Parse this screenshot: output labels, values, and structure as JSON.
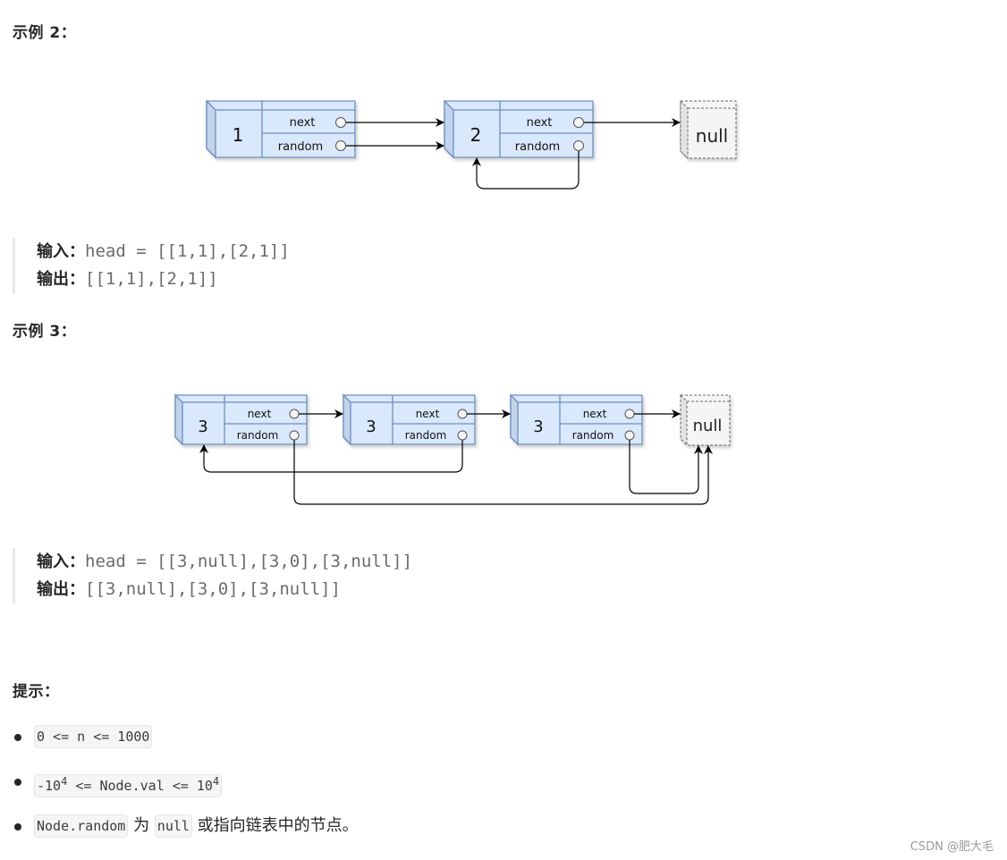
{
  "example2": {
    "heading": "示例 2：",
    "nodes": [
      {
        "val": "1",
        "next_label": "next",
        "random_label": "random"
      },
      {
        "val": "2",
        "next_label": "next",
        "random_label": "random"
      }
    ],
    "null_label": "null",
    "input_label": "输入：",
    "input_value": "head = [[1,1],[2,1]]",
    "output_label": "输出：",
    "output_value": "[[1,1],[2,1]]"
  },
  "example3": {
    "heading": "示例 3：",
    "nodes": [
      {
        "val": "3",
        "next_label": "next",
        "random_label": "random"
      },
      {
        "val": "3",
        "next_label": "next",
        "random_label": "random"
      },
      {
        "val": "3",
        "next_label": "next",
        "random_label": "random"
      }
    ],
    "null_label": "null",
    "input_label": "输入：",
    "input_value": "head = [[3,null],[3,0],[3,null]]",
    "output_label": "输出：",
    "output_value": "[[3,null],[3,0],[3,null]]"
  },
  "tips": {
    "heading": "提示：",
    "item1_code": "0 <= n <= 1000",
    "item2_a": "-10",
    "item2_exp1": "4",
    "item2_b": " <= Node.val <= 10",
    "item2_exp2": "4",
    "item3_code1": "Node.random",
    "item3_text1": " 为 ",
    "item3_code2": "null",
    "item3_text2": " 或指向链表中的节点。"
  },
  "watermark": "CSDN @肥大毛",
  "colors": {
    "node_fill": "#dae8fc",
    "node_stroke": "#6c8ebf",
    "null_fill": "#f5f5f5",
    "null_stroke": "#666666"
  }
}
